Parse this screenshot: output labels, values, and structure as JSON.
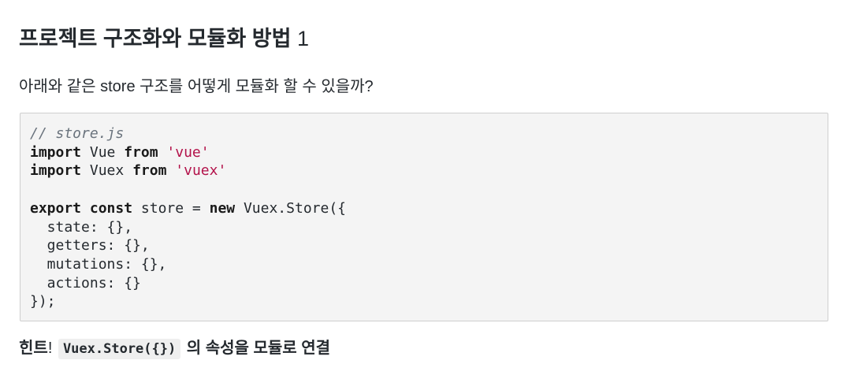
{
  "title": {
    "text": "프로젝트 구조화와 모듈화 방법",
    "number": "1"
  },
  "question": "아래와 같은 store 구조를 어떻게 모듈화 할 수 있을까?",
  "code": {
    "comment": "// store.js",
    "line2": {
      "kw": "import",
      "name": " Vue ",
      "kw2": "from",
      "str": "'vue'"
    },
    "line3": {
      "kw": "import",
      "name": " Vuex ",
      "kw2": "from",
      "str": "'vuex'"
    },
    "line5": {
      "kw": "export",
      "kw2": "const",
      "mid": " store = ",
      "kw3": "new",
      "rest": " Vuex.Store({"
    },
    "line6": "  state: {},",
    "line7": "  getters: {},",
    "line8": "  mutations: {},",
    "line9": "  actions: {}",
    "line10": "});"
  },
  "hint": {
    "label": "힌트",
    "bang": "!",
    "code": "Vuex.Store({})",
    "rest": "의 속성을 모듈로 연결"
  }
}
